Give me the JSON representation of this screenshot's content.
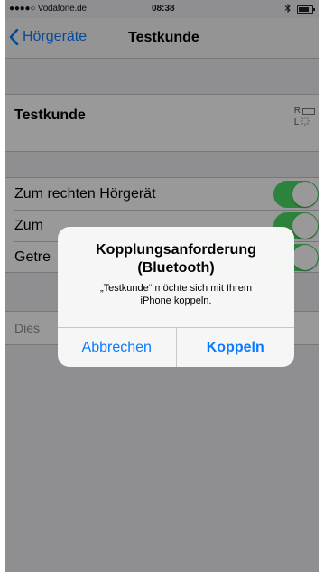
{
  "status_bar": {
    "carrier": "●●●●○ Vodafone.de",
    "time": "08:38"
  },
  "nav": {
    "back_label": "Hörgeräte",
    "title": "Testkunde"
  },
  "device": {
    "name": "Testkunde",
    "right_label": "R",
    "left_label": "L"
  },
  "settings": [
    {
      "label": "Zum rechten Hörgerät",
      "enabled": true
    },
    {
      "label": "Zum",
      "enabled": true
    },
    {
      "label": "Getre",
      "enabled": true
    }
  ],
  "footer_cell": {
    "label": "Dies"
  },
  "alert": {
    "title_line1": "Kopplungsanforderung",
    "title_line2": "(Bluetooth)",
    "message_line1": "„Testkunde“ möchte sich mit Ihrem",
    "message_line2": "iPhone koppeln.",
    "cancel_label": "Abbrechen",
    "confirm_label": "Koppeln"
  },
  "colors": {
    "accent": "#0a7aff",
    "toggle_on": "#4cd964",
    "background": "#efeff4"
  }
}
